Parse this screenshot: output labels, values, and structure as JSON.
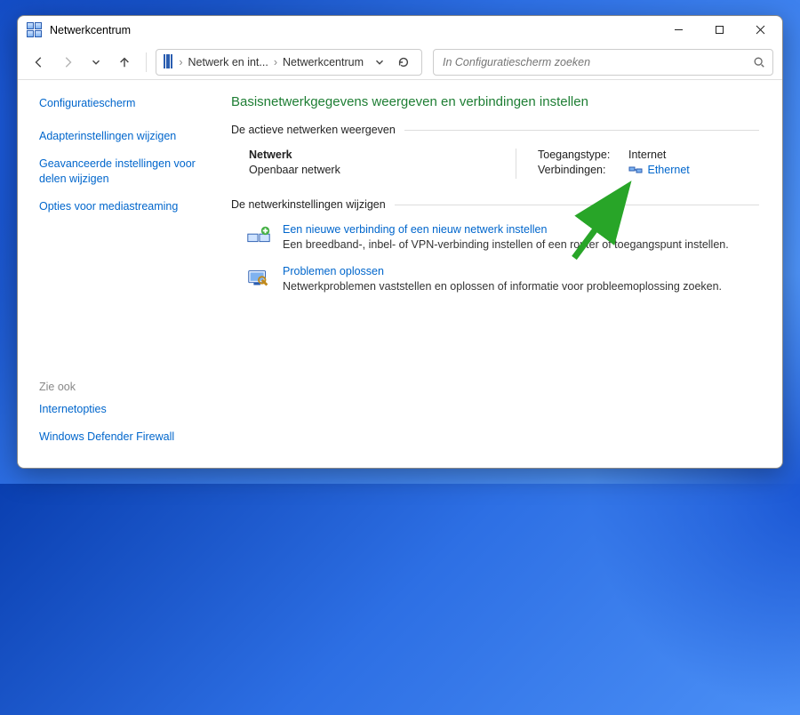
{
  "window": {
    "title": "Netwerkcentrum"
  },
  "breadcrumb": {
    "part1": "Netwerk en int...",
    "part2": "Netwerkcentrum"
  },
  "search": {
    "placeholder": "In Configuratiescherm zoeken"
  },
  "sidebar": {
    "home": "Configuratiescherm",
    "links": [
      "Adapterinstellingen wijzigen",
      "Geavanceerde instellingen voor delen wijzigen",
      "Opties voor mediastreaming"
    ],
    "also_label": "Zie ook",
    "also": [
      "Internetopties",
      "Windows Defender Firewall"
    ]
  },
  "content": {
    "title": "Basisnetwerkgegevens weergeven en verbindingen instellen",
    "active_header": "De actieve netwerken weergeven",
    "network": {
      "name": "Netwerk",
      "profile": "Openbaar netwerk",
      "access_label": "Toegangstype:",
      "access_value": "Internet",
      "conn_label": "Verbindingen:",
      "conn_value": "Ethernet"
    },
    "change_header": "De netwerkinstellingen wijzigen",
    "tasks": [
      {
        "link": "Een nieuwe verbinding of een nieuw netwerk instellen",
        "desc": "Een breedband-, inbel- of VPN-verbinding instellen of een router of toegangspunt instellen."
      },
      {
        "link": "Problemen oplossen",
        "desc": "Netwerkproblemen vaststellen en oplossen of informatie voor probleemoplossing zoeken."
      }
    ]
  }
}
